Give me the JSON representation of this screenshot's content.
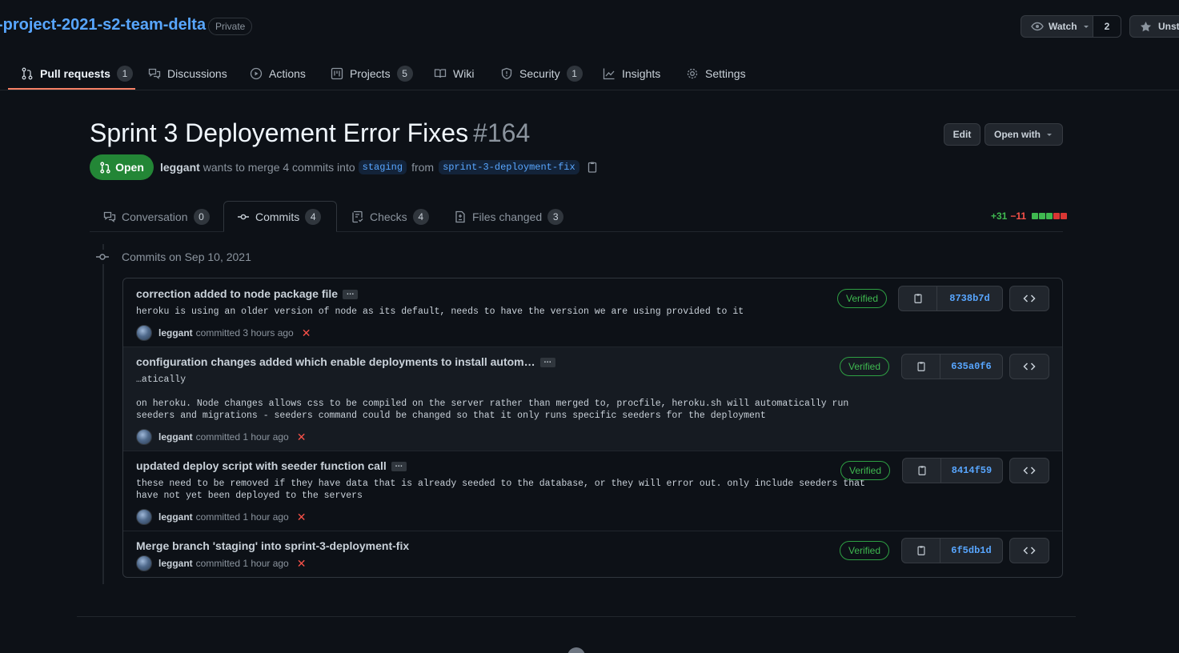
{
  "repo": {
    "name": "-project-2021-s2-team-delta",
    "visibility": "Private",
    "watch_label": "Watch",
    "watch_count": "2",
    "star_label": "Unstar"
  },
  "nav": {
    "pull_requests": {
      "label": "Pull requests",
      "count": "1"
    },
    "discussions": {
      "label": "Discussions"
    },
    "actions": {
      "label": "Actions"
    },
    "projects": {
      "label": "Projects",
      "count": "5"
    },
    "wiki": {
      "label": "Wiki"
    },
    "security": {
      "label": "Security",
      "count": "1"
    },
    "insights": {
      "label": "Insights"
    },
    "settings": {
      "label": "Settings"
    }
  },
  "pr": {
    "title": "Sprint 3 Deployement Error Fixes",
    "number": "#164",
    "edit_label": "Edit",
    "open_with_label": "Open with",
    "state": "Open",
    "author": "leggant",
    "merge_text": "wants to merge 4 commits into",
    "base_branch": "staging",
    "from_text": "from",
    "head_branch": "sprint-3-deployment-fix"
  },
  "tabs": {
    "conversation": {
      "label": "Conversation",
      "count": "0"
    },
    "commits": {
      "label": "Commits",
      "count": "4"
    },
    "checks": {
      "label": "Checks",
      "count": "4"
    },
    "files": {
      "label": "Files changed",
      "count": "3"
    }
  },
  "diffstat": {
    "additions": "+31",
    "deletions": "−11",
    "blocks": [
      "#3fb950",
      "#3fb950",
      "#3fb950",
      "#da3633",
      "#da3633"
    ]
  },
  "commits_date": "Commits on Sep 10, 2021",
  "commits": [
    {
      "title": "correction added to node package file",
      "body": "heroku is using an older version of node as its default, needs to have the version we are using provided to it",
      "author": "leggant",
      "meta": "committed 3 hours ago",
      "verified": "Verified",
      "sha": "8738b7d"
    },
    {
      "title": "configuration changes added which enable deployments to install autom…",
      "body": "…atically\n\non heroku. Node changes allows css to be compiled on the server rather than merged to, procfile, heroku.sh will automatically run\nseeders and migrations - seeders command could be changed so that it only runs specific seeders for the deployment",
      "author": "leggant",
      "meta": "committed 1 hour ago",
      "verified": "Verified",
      "sha": "635a0f6"
    },
    {
      "title": "updated deploy script with seeder function call",
      "body": "these need to be removed if they have data that is already seeded to the database, or they will error out. only include seeders that\nhave not yet been deployed to the servers",
      "author": "leggant",
      "meta": "committed 1 hour ago",
      "verified": "Verified",
      "sha": "8414f59"
    },
    {
      "title": "Merge branch 'staging' into sprint-3-deployment-fix",
      "body": "",
      "author": "leggant",
      "meta": "committed 1 hour ago",
      "verified": "Verified",
      "sha": "6f5db1d"
    }
  ]
}
